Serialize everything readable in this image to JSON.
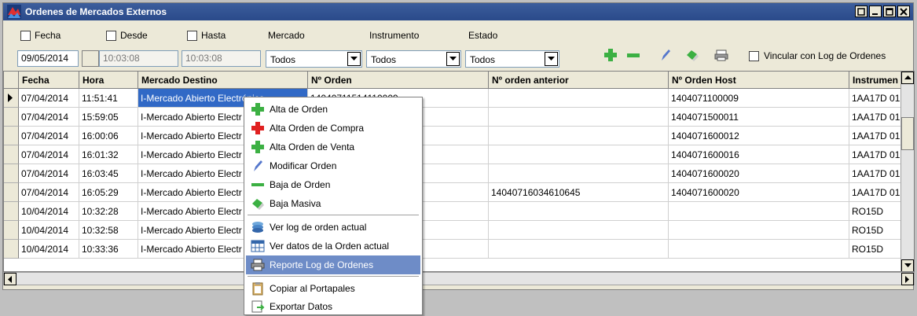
{
  "window": {
    "title": "Ordenes de Mercados Externos"
  },
  "filters": {
    "fecha_label": "Fecha",
    "fecha_value": "09/05/2014",
    "desde_label": "Desde",
    "desde_value": "10:03:08",
    "hasta_label": "Hasta",
    "hasta_value": "10:03:08",
    "mercado_label": "Mercado",
    "mercado_value": "Todos",
    "instrumento_label": "Instrumento",
    "instrumento_value": "Todos",
    "estado_label": "Estado",
    "estado_value": "Todos",
    "vincular_label": "Vincular con Log de Ordenes"
  },
  "toolbar": {
    "icons": [
      "plus-icon",
      "minus-icon",
      "pencil-icon",
      "eraser-icon",
      "printer-icon"
    ]
  },
  "grid": {
    "columns": [
      "Fecha",
      "Hora",
      "Mercado Destino",
      "Nº Orden",
      "Nº orden anterior",
      "Nº Orden Host",
      "Instrumen"
    ],
    "rows": [
      [
        "07/04/2014",
        "11:51:41",
        "I-Mercado Abierto Electrónico",
        "14040711514110009",
        "",
        "1404071100009",
        "1AA17D 01"
      ],
      [
        "07/04/2014",
        "15:59:05",
        "I-Mercado Abierto Electr",
        "",
        "",
        "1404071500011",
        "1AA17D 01"
      ],
      [
        "07/04/2014",
        "16:00:06",
        "I-Mercado Abierto Electr",
        "",
        "",
        "1404071600012",
        "1AA17D 01"
      ],
      [
        "07/04/2014",
        "16:01:32",
        "I-Mercado Abierto Electr",
        "",
        "",
        "1404071600016",
        "1AA17D 01"
      ],
      [
        "07/04/2014",
        "16:03:45",
        "I-Mercado Abierto Electr",
        "",
        "",
        "1404071600020",
        "1AA17D 01"
      ],
      [
        "07/04/2014",
        "16:05:29",
        "I-Mercado Abierto Electr",
        "",
        "14040716034610645",
        "1404071600020",
        "1AA17D 01"
      ],
      [
        "10/04/2014",
        "10:32:28",
        "I-Mercado Abierto Electr",
        "",
        "",
        "",
        "RO15D"
      ],
      [
        "10/04/2014",
        "10:32:58",
        "I-Mercado Abierto Electr",
        "",
        "",
        "",
        "RO15D"
      ],
      [
        "10/04/2014",
        "10:33:36",
        "I-Mercado Abierto Electr",
        "",
        "",
        "",
        "RO15D"
      ]
    ]
  },
  "context_menu": {
    "items": [
      {
        "label": "Alta de Orden",
        "icon": "plus-green-icon"
      },
      {
        "label": "Alta Orden de Compra",
        "icon": "plus-red-icon"
      },
      {
        "label": "Alta Orden de Venta",
        "icon": "plus-green-icon"
      },
      {
        "label": "Modificar Orden",
        "icon": "pencil-icon"
      },
      {
        "label": "Baja de Orden",
        "icon": "minus-icon"
      },
      {
        "label": "Baja Masiva",
        "icon": "eraser-icon"
      },
      {
        "label": "Ver log de orden actual",
        "icon": "log-icon"
      },
      {
        "label": "Ver datos de la Orden actual",
        "icon": "grid-icon"
      },
      {
        "label": "Reporte Log de Ordenes",
        "icon": "printer-icon"
      },
      {
        "label": "Copiar al Portapales",
        "icon": "clipboard-icon"
      },
      {
        "label": "Exportar Datos",
        "icon": "export-icon"
      }
    ]
  },
  "colors": {
    "title_bar": "#2a4a8a",
    "selection": "#3169c6",
    "menu_highlight": "#6e8cc7",
    "green": "#3cb043",
    "red": "#e02020"
  }
}
